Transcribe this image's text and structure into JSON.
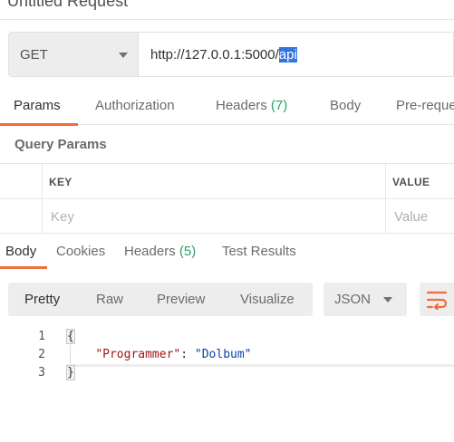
{
  "window": {
    "title": "Untitled Request"
  },
  "request": {
    "method": "GET",
    "url_prefix": "http://127.0.0.1:5000/",
    "url_selected": "api"
  },
  "request_tabs": {
    "params": "Params",
    "authorization": "Authorization",
    "headers": "Headers",
    "headers_count": "(7)",
    "body": "Body",
    "prerequest": "Pre-reque"
  },
  "query_params": {
    "title": "Query Params",
    "key_header": "KEY",
    "value_header": "VALUE",
    "key_placeholder": "Key",
    "value_placeholder": "Value"
  },
  "response_tabs": {
    "body": "Body",
    "cookies": "Cookies",
    "headers": "Headers",
    "headers_count": "(5)",
    "test_results": "Test Results"
  },
  "view_options": {
    "pretty": "Pretty",
    "raw": "Raw",
    "preview": "Preview",
    "visualize": "Visualize",
    "format": "JSON"
  },
  "code": {
    "line_numbers": [
      "1",
      "2",
      "3"
    ],
    "open_brace": "{",
    "indent": "    ",
    "key": "\"Programmer\"",
    "colon": ": ",
    "value": "\"Dolbum\"",
    "close_brace": "}"
  },
  "colors": {
    "accent": "#f26b3a",
    "count_green": "#26a269",
    "selection": "#3375e0"
  },
  "icons": {
    "method_dropdown": "chevron-down-icon",
    "format_dropdown": "chevron-down-icon",
    "wrap": "wrap-lines-icon"
  }
}
